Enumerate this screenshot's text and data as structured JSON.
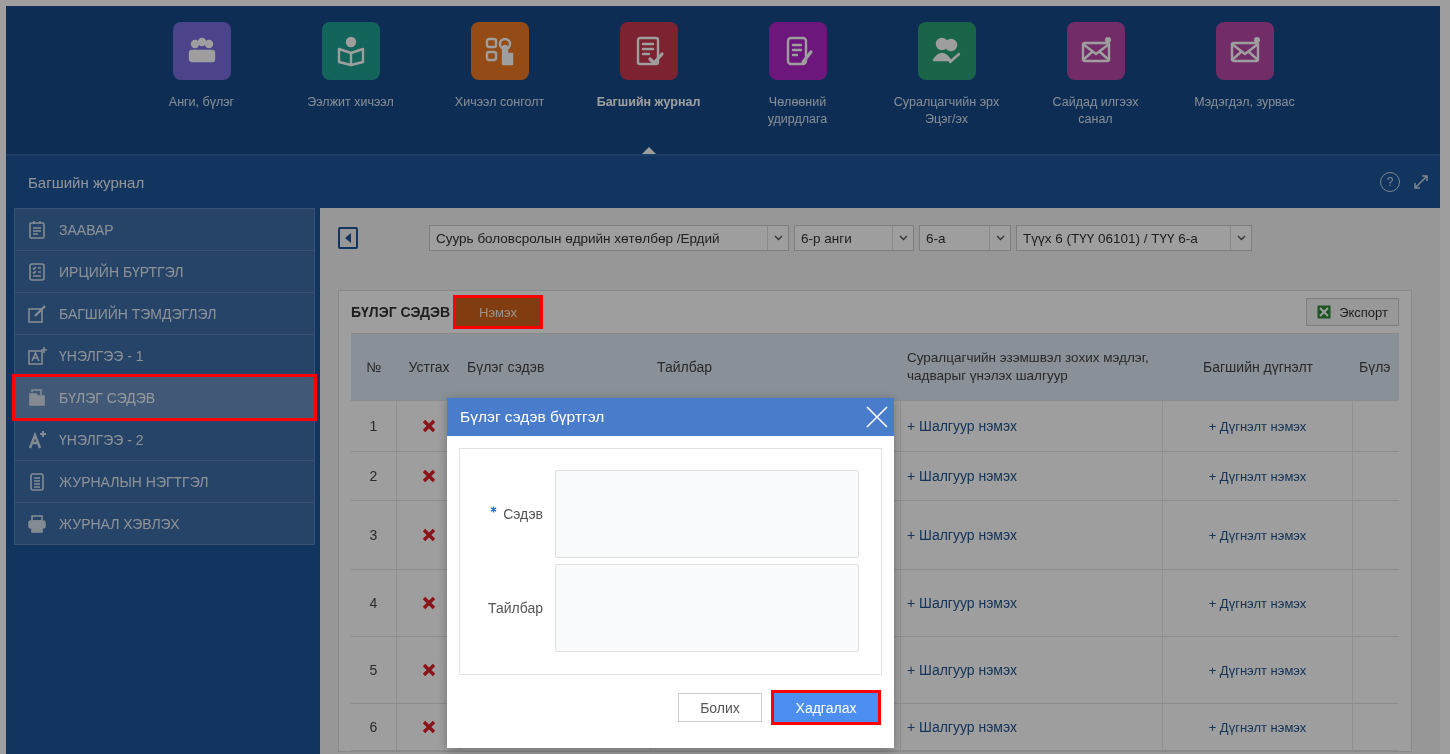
{
  "nav": {
    "items": [
      {
        "label": "Анги, бүлэг",
        "selected": false
      },
      {
        "label": "Ээлжит хичээл",
        "selected": false
      },
      {
        "label": "Хичээл сонголт",
        "selected": false
      },
      {
        "label": "Багшийн журнал",
        "selected": true
      },
      {
        "label": "Чөлөөний удирдлага",
        "selected": false
      },
      {
        "label": "Суралцагчийн эрх Эцэг/эх",
        "selected": false
      },
      {
        "label": "Сайдад илгээх санал",
        "selected": false
      },
      {
        "label": "Мэдэгдэл, зурвас",
        "selected": false
      }
    ]
  },
  "header": {
    "title": "Багшийн журнал",
    "help": "?"
  },
  "sidebar": {
    "items": [
      {
        "label": "ЗААВАР",
        "selected": false,
        "highlighted": false
      },
      {
        "label": "ИРЦИЙН БҮРТГЭЛ",
        "selected": false,
        "highlighted": false
      },
      {
        "label": "БАГШИЙН ТЭМДЭГЛЭЛ",
        "selected": false,
        "highlighted": false
      },
      {
        "label": "ҮНЭЛГЭЭ - 1",
        "selected": false,
        "highlighted": false
      },
      {
        "label": "БҮЛЭГ СЭДЭВ",
        "selected": true,
        "highlighted": true
      },
      {
        "label": "ҮНЭЛГЭЭ - 2",
        "selected": false,
        "highlighted": false
      },
      {
        "label": "ЖУРНАЛЫН НЭГТГЭЛ",
        "selected": false,
        "highlighted": false
      },
      {
        "label": "ЖУРНАЛ ХЭВЛЭХ",
        "selected": false,
        "highlighted": false
      }
    ]
  },
  "filters": [
    {
      "value": "Суурь боловсролын өдрийн хөтөлбөр /Ердий"
    },
    {
      "value": "6-р анги"
    },
    {
      "value": "6-а"
    },
    {
      "value": "Түүх 6 (ТҮҮ 06101) / ТҮҮ 6-а"
    }
  ],
  "section": {
    "title": "БҮЛЭГ СЭДЭВ",
    "add_button": {
      "label": "Нэмэх",
      "highlighted": true
    },
    "export_button": {
      "label": "Экспорт"
    }
  },
  "table": {
    "columns": [
      "№",
      "Устгах",
      "Бүлэг сэдэв",
      "Тайлбар",
      "Суралцагчийн эзэмшвэл зохих мэдлэг, чадварыг үнэлэх шалгуур",
      "Багшийн дүгнэлт",
      "Бүлэ"
    ],
    "rows": [
      {
        "no": "1",
        "criterion": "+ Шалгуур нэмэх",
        "conclusion": "+ Дүгнэлт нэмэх"
      },
      {
        "no": "2",
        "criterion": "+ Шалгуур нэмэх",
        "conclusion": "+ Дүгнэлт нэмэх"
      },
      {
        "no": "3",
        "criterion": "+ Шалгуур нэмэх",
        "conclusion": "+ Дүгнэлт нэмэх"
      },
      {
        "no": "4",
        "criterion": "+ Шалгуур нэмэх",
        "conclusion": "+ Дүгнэлт нэмэх"
      },
      {
        "no": "5",
        "criterion": "+ Шалгуур нэмэх",
        "conclusion": "+ Дүгнэлт нэмэх"
      },
      {
        "no": "6",
        "criterion": "+ Шалгуур нэмэх",
        "conclusion": "+ Дүгнэлт нэмэх"
      }
    ]
  },
  "dialog": {
    "title": "Бүлэг сэдэв бүртгэл",
    "fields": [
      {
        "label": "Сэдэв",
        "required": true
      },
      {
        "label": "Тайлбар",
        "required": false
      }
    ],
    "buttons": [
      {
        "label": "Болих",
        "kind": "secondary",
        "highlighted": false
      },
      {
        "label": "Хадгалах",
        "kind": "primary",
        "highlighted": true
      }
    ]
  }
}
